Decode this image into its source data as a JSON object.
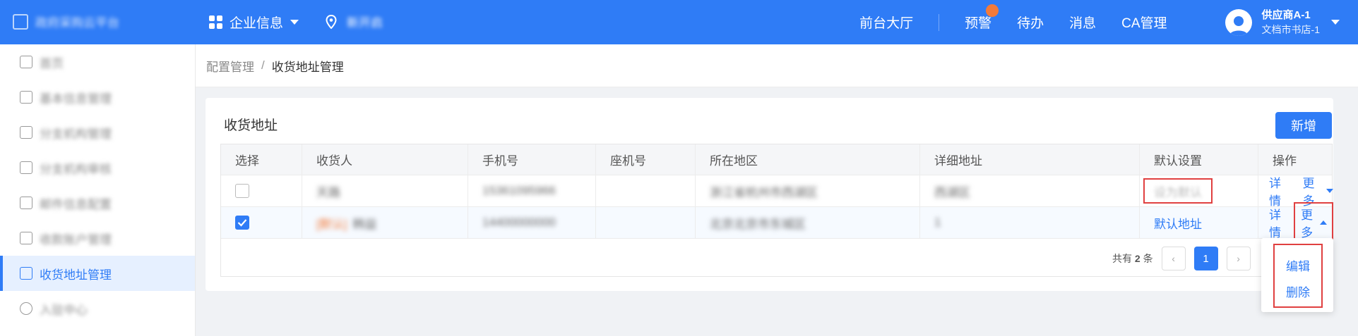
{
  "topbar": {
    "logo_text": "政府采购云平台",
    "menu_label": "企业信息",
    "location_text": "新开启",
    "links": [
      "前台大厅",
      "预警",
      "待办",
      "消息",
      "CA管理"
    ],
    "user_name": "供应商A-1",
    "user_sub": "文档市书店-1"
  },
  "sidebar": {
    "items": [
      {
        "label": "首页"
      },
      {
        "label": "基本信息管理"
      },
      {
        "label": "分支机构管理"
      },
      {
        "label": "分支机构审核"
      },
      {
        "label": "邮件信息配置"
      },
      {
        "label": "收款账户管理"
      },
      {
        "label": "收货地址管理"
      },
      {
        "label": "入驻中心"
      }
    ]
  },
  "breadcrumb": {
    "parent": "配置管理",
    "current": "收货地址管理"
  },
  "card": {
    "title": "收货地址",
    "new_button": "新增"
  },
  "table": {
    "columns": [
      "选择",
      "收货人",
      "手机号",
      "座机号",
      "所在地区",
      "详细地址",
      "默认设置",
      "操作"
    ],
    "rows": [
      {
        "checked": false,
        "receiver": "天路",
        "phone": "15361095966",
        "landline": "",
        "region": "浙江省杭州市西湖区",
        "address": "西湖区",
        "default": "设为默认",
        "detail": "详情",
        "more": "更多"
      },
      {
        "checked": true,
        "tag": "[默认]",
        "receiver": "韩益",
        "phone": "14400000000",
        "landline": "",
        "region": "北京北京市东城区",
        "address": "1",
        "default": "默认地址",
        "detail": "详情",
        "more": "更多"
      }
    ]
  },
  "pager": {
    "total_prefix": "共有",
    "total": "2",
    "total_suffix": "条",
    "current": "1",
    "prev": "‹",
    "next": "›"
  },
  "dropdown": {
    "items": [
      "编辑",
      "删除"
    ]
  }
}
